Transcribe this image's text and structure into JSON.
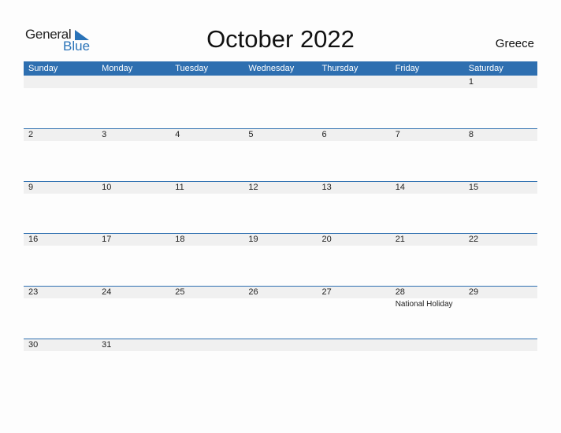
{
  "logo": {
    "word1": "General",
    "word2": "Blue"
  },
  "title": "October 2022",
  "country": "Greece",
  "colors": {
    "accent": "#2e6fb0",
    "band": "#f0f0f0"
  },
  "weekdays": [
    "Sunday",
    "Monday",
    "Tuesday",
    "Wednesday",
    "Thursday",
    "Friday",
    "Saturday"
  ],
  "weeks": [
    [
      "",
      "",
      "",
      "",
      "",
      "",
      "1"
    ],
    [
      "2",
      "3",
      "4",
      "5",
      "6",
      "7",
      "8"
    ],
    [
      "9",
      "10",
      "11",
      "12",
      "13",
      "14",
      "15"
    ],
    [
      "16",
      "17",
      "18",
      "19",
      "20",
      "21",
      "22"
    ],
    [
      "23",
      "24",
      "25",
      "26",
      "27",
      "28",
      "29"
    ],
    [
      "30",
      "31",
      "",
      "",
      "",
      "",
      ""
    ]
  ],
  "events": {
    "28": "National Holiday"
  }
}
